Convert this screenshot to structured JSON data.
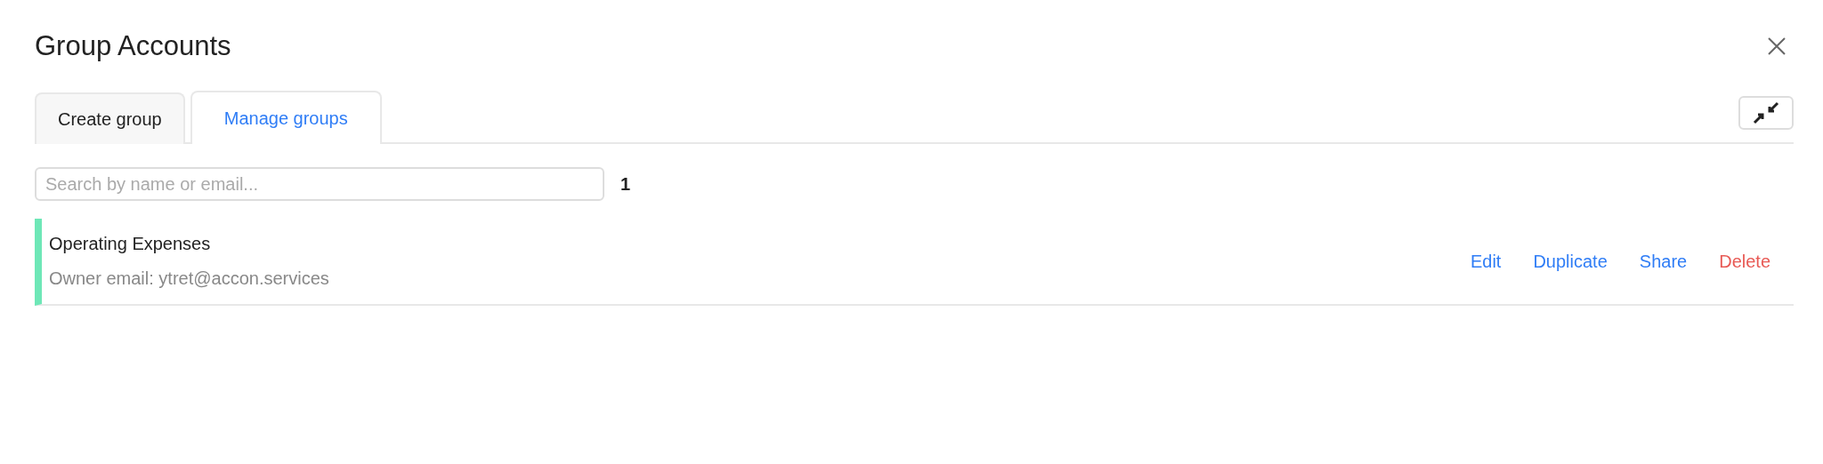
{
  "dialog": {
    "title": "Group Accounts"
  },
  "tabs": [
    {
      "label": "Create group",
      "selected": false
    },
    {
      "label": "Manage groups",
      "selected": true
    }
  ],
  "search": {
    "placeholder": "Search by name or email...",
    "count": "1"
  },
  "groups": [
    {
      "name": "Operating Expenses",
      "owner": "Owner email: ytret@accon.services",
      "color": "#6ee7b7",
      "actions": [
        {
          "label": "Edit",
          "kind": "normal"
        },
        {
          "label": "Duplicate",
          "kind": "normal"
        },
        {
          "label": "Share",
          "kind": "normal"
        },
        {
          "label": "Delete",
          "kind": "danger"
        }
      ]
    }
  ]
}
